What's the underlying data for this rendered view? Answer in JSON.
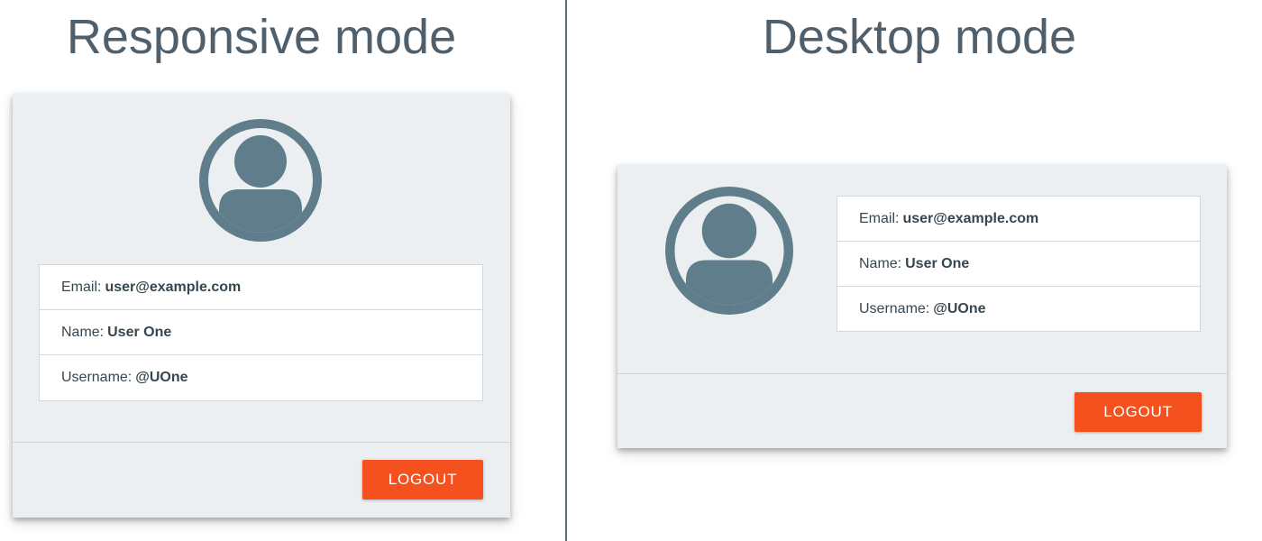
{
  "colors": {
    "accent": "#f4511e",
    "avatar": "#607d8b",
    "card_background": "#eceff1",
    "divider": "#546e7a"
  },
  "responsive": {
    "title": "Responsive mode",
    "avatar_icon": "account-circle-icon",
    "email_label": "Email:",
    "email_value": "user@example.com",
    "name_label": "Name:",
    "name_value": "User One",
    "username_label": "Username:",
    "username_value": "@UOne",
    "logout_label": "LOGOUT"
  },
  "desktop": {
    "title": "Desktop mode",
    "avatar_icon": "account-circle-icon",
    "email_label": "Email:",
    "email_value": "user@example.com",
    "name_label": "Name:",
    "name_value": "User One",
    "username_label": "Username:",
    "username_value": "@UOne",
    "logout_label": "LOGOUT"
  }
}
